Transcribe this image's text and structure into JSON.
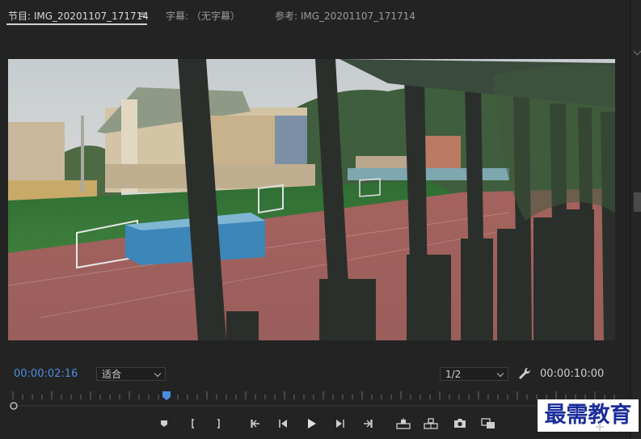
{
  "tabs": [
    {
      "label": "节目: IMG_20201107_171714"
    },
    {
      "label": "字幕: （无字幕）"
    },
    {
      "label": "参考: IMG_20201107_171714"
    }
  ],
  "menu_glyph": "≡",
  "timecode_current": "00:00:02:16",
  "timecode_duration": "00:00:10:00",
  "zoom_select": {
    "value": "适合"
  },
  "resolution_select": {
    "value": "1/2"
  },
  "watermark": "最需教育",
  "accent_color": "#4a8ee0",
  "icons": [
    "marker-icon",
    "mark-in-icon",
    "mark-out-icon",
    "go-to-in-icon",
    "step-back-icon",
    "play-icon",
    "step-forward-icon",
    "go-to-out-icon",
    "lift-icon",
    "extract-icon",
    "camera-icon",
    "compare-icon",
    "add-button-icon",
    "wrench-icon"
  ]
}
